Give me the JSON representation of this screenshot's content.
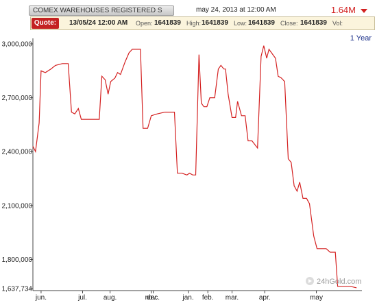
{
  "header": {
    "title": "COMEX WAREHOUSES REGISTERED S",
    "datetime": "may 24, 2013 at 12:00 AM",
    "last_value": "1.64M",
    "accent_color": "#d22020"
  },
  "quote": {
    "label": "Quote:",
    "date": "13/05/24 12:00 AM",
    "open_label": "Open:",
    "open_value": "1641839",
    "high_label": "High:",
    "high_value": "1641839",
    "low_label": "Low:",
    "low_value": "1641839",
    "close_label": "Close:",
    "close_value": "1641839",
    "vol_label": "Vol:"
  },
  "period": "1 Year",
  "watermark": "24hGold.com",
  "chart_data": {
    "type": "line",
    "line_color": "#d42020",
    "grid": false,
    "ylim": [
      1637734,
      3000000
    ],
    "y_ticks": [
      {
        "value": 3000000,
        "label": "3,000,000"
      },
      {
        "value": 2700000,
        "label": "2,700,000"
      },
      {
        "value": 2400000,
        "label": "2,400,000"
      },
      {
        "value": 2100000,
        "label": "2,100,000"
      },
      {
        "value": 1800000,
        "label": "1,800,000"
      },
      {
        "value": 1637734,
        "label": "1,637,734"
      }
    ],
    "x_ticks": [
      {
        "pos": 0.025,
        "label": "jun."
      },
      {
        "pos": 0.152,
        "label": "jul."
      },
      {
        "pos": 0.236,
        "label": "aug."
      },
      {
        "pos": 0.362,
        "label": "nov."
      },
      {
        "pos": 0.368,
        "label": "dec."
      },
      {
        "pos": 0.475,
        "label": "jan."
      },
      {
        "pos": 0.535,
        "label": "feb."
      },
      {
        "pos": 0.609,
        "label": "mar."
      },
      {
        "pos": 0.709,
        "label": "apr."
      },
      {
        "pos": 0.867,
        "label": "may"
      }
    ],
    "points": [
      {
        "x": 0.0,
        "y": 2430000
      },
      {
        "x": 0.008,
        "y": 2400000
      },
      {
        "x": 0.019,
        "y": 2560000
      },
      {
        "x": 0.025,
        "y": 2850000
      },
      {
        "x": 0.038,
        "y": 2840000
      },
      {
        "x": 0.055,
        "y": 2860000
      },
      {
        "x": 0.069,
        "y": 2880000
      },
      {
        "x": 0.09,
        "y": 2890000
      },
      {
        "x": 0.108,
        "y": 2890000
      },
      {
        "x": 0.118,
        "y": 2620000
      },
      {
        "x": 0.128,
        "y": 2610000
      },
      {
        "x": 0.139,
        "y": 2640000
      },
      {
        "x": 0.148,
        "y": 2580000
      },
      {
        "x": 0.163,
        "y": 2580000
      },
      {
        "x": 0.186,
        "y": 2580000
      },
      {
        "x": 0.203,
        "y": 2580000
      },
      {
        "x": 0.211,
        "y": 2820000
      },
      {
        "x": 0.221,
        "y": 2800000
      },
      {
        "x": 0.23,
        "y": 2720000
      },
      {
        "x": 0.238,
        "y": 2790000
      },
      {
        "x": 0.251,
        "y": 2810000
      },
      {
        "x": 0.259,
        "y": 2840000
      },
      {
        "x": 0.268,
        "y": 2830000
      },
      {
        "x": 0.282,
        "y": 2900000
      },
      {
        "x": 0.294,
        "y": 2950000
      },
      {
        "x": 0.304,
        "y": 2970000
      },
      {
        "x": 0.315,
        "y": 2970000
      },
      {
        "x": 0.329,
        "y": 2970000
      },
      {
        "x": 0.337,
        "y": 2530000
      },
      {
        "x": 0.351,
        "y": 2530000
      },
      {
        "x": 0.362,
        "y": 2600000
      },
      {
        "x": 0.38,
        "y": 2610000
      },
      {
        "x": 0.404,
        "y": 2620000
      },
      {
        "x": 0.422,
        "y": 2620000
      },
      {
        "x": 0.433,
        "y": 2620000
      },
      {
        "x": 0.442,
        "y": 2280000
      },
      {
        "x": 0.456,
        "y": 2280000
      },
      {
        "x": 0.471,
        "y": 2270000
      },
      {
        "x": 0.479,
        "y": 2280000
      },
      {
        "x": 0.489,
        "y": 2270000
      },
      {
        "x": 0.498,
        "y": 2270000
      },
      {
        "x": 0.508,
        "y": 2940000
      },
      {
        "x": 0.515,
        "y": 2670000
      },
      {
        "x": 0.523,
        "y": 2650000
      },
      {
        "x": 0.532,
        "y": 2650000
      },
      {
        "x": 0.541,
        "y": 2700000
      },
      {
        "x": 0.556,
        "y": 2700000
      },
      {
        "x": 0.567,
        "y": 2860000
      },
      {
        "x": 0.575,
        "y": 2880000
      },
      {
        "x": 0.584,
        "y": 2860000
      },
      {
        "x": 0.589,
        "y": 2860000
      },
      {
        "x": 0.597,
        "y": 2720000
      },
      {
        "x": 0.609,
        "y": 2590000
      },
      {
        "x": 0.62,
        "y": 2590000
      },
      {
        "x": 0.626,
        "y": 2680000
      },
      {
        "x": 0.638,
        "y": 2600000
      },
      {
        "x": 0.649,
        "y": 2600000
      },
      {
        "x": 0.658,
        "y": 2460000
      },
      {
        "x": 0.67,
        "y": 2460000
      },
      {
        "x": 0.687,
        "y": 2420000
      },
      {
        "x": 0.698,
        "y": 2930000
      },
      {
        "x": 0.706,
        "y": 2990000
      },
      {
        "x": 0.715,
        "y": 2920000
      },
      {
        "x": 0.722,
        "y": 2970000
      },
      {
        "x": 0.73,
        "y": 2950000
      },
      {
        "x": 0.742,
        "y": 2920000
      },
      {
        "x": 0.75,
        "y": 2820000
      },
      {
        "x": 0.76,
        "y": 2810000
      },
      {
        "x": 0.77,
        "y": 2790000
      },
      {
        "x": 0.781,
        "y": 2360000
      },
      {
        "x": 0.79,
        "y": 2340000
      },
      {
        "x": 0.799,
        "y": 2210000
      },
      {
        "x": 0.808,
        "y": 2180000
      },
      {
        "x": 0.816,
        "y": 2230000
      },
      {
        "x": 0.826,
        "y": 2140000
      },
      {
        "x": 0.837,
        "y": 2140000
      },
      {
        "x": 0.846,
        "y": 2110000
      },
      {
        "x": 0.859,
        "y": 1930000
      },
      {
        "x": 0.869,
        "y": 1860000
      },
      {
        "x": 0.88,
        "y": 1860000
      },
      {
        "x": 0.897,
        "y": 1860000
      },
      {
        "x": 0.909,
        "y": 1840000
      },
      {
        "x": 0.925,
        "y": 1840000
      },
      {
        "x": 0.932,
        "y": 1650000
      },
      {
        "x": 0.948,
        "y": 1650000
      },
      {
        "x": 0.971,
        "y": 1650000
      },
      {
        "x": 0.99,
        "y": 1641839
      }
    ]
  }
}
